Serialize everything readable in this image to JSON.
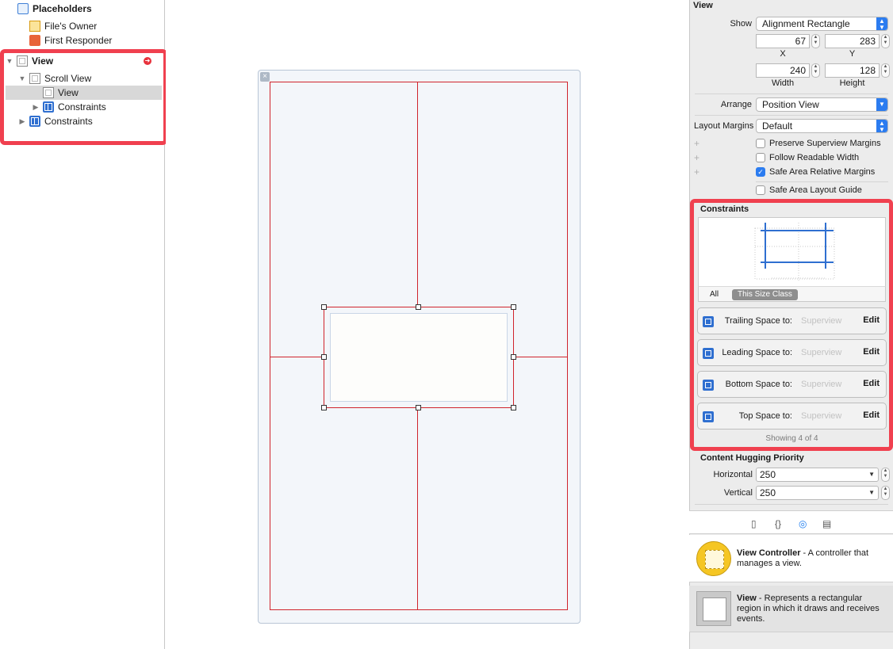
{
  "outline": {
    "placeholders": "Placeholders",
    "files_owner": "File's Owner",
    "first_responder": "First Responder",
    "view": "View",
    "scroll_view": "Scroll View",
    "inner_view": "View",
    "constraints_inner": "Constraints",
    "constraints_outer": "Constraints"
  },
  "inspector": {
    "section_title": "View",
    "show_label": "Show",
    "show_value": "Alignment Rectangle",
    "x_value": "67",
    "y_value": "283",
    "x_caption": "X",
    "y_caption": "Y",
    "width_value": "240",
    "height_value": "128",
    "width_caption": "Width",
    "height_caption": "Height",
    "arrange_label": "Arrange",
    "arrange_value": "Position View",
    "layout_margins_label": "Layout Margins",
    "layout_margins_value": "Default",
    "preserve_margins": "Preserve Superview Margins",
    "follow_readable": "Follow Readable Width",
    "safe_area_margins": "Safe Area Relative Margins",
    "safe_area_guide": "Safe Area Layout Guide",
    "constraints_title": "Constraints",
    "tab_all": "All",
    "tab_size_class": "This Size Class",
    "constraint_rows": [
      {
        "label": "Trailing Space to:",
        "target": "Superview",
        "edit": "Edit"
      },
      {
        "label": "Leading Space to:",
        "target": "Superview",
        "edit": "Edit"
      },
      {
        "label": "Bottom Space to:",
        "target": "Superview",
        "edit": "Edit"
      },
      {
        "label": "Top Space to:",
        "target": "Superview",
        "edit": "Edit"
      }
    ],
    "showing": "Showing 4 of 4",
    "hugging_title": "Content Hugging Priority",
    "horizontal_label": "Horizontal",
    "horizontal_value": "250",
    "vertical_label": "Vertical",
    "vertical_value": "250"
  },
  "library": {
    "vc_title": "View Controller",
    "vc_desc": " - A controller that manages a view.",
    "view_title": "View",
    "view_desc": " - Represents a rectangular region in which it draws and receives events."
  },
  "colors": {
    "highlight": "#f0404f",
    "constraint_red": "#d0242c",
    "accent_blue": "#2b7cf0"
  }
}
